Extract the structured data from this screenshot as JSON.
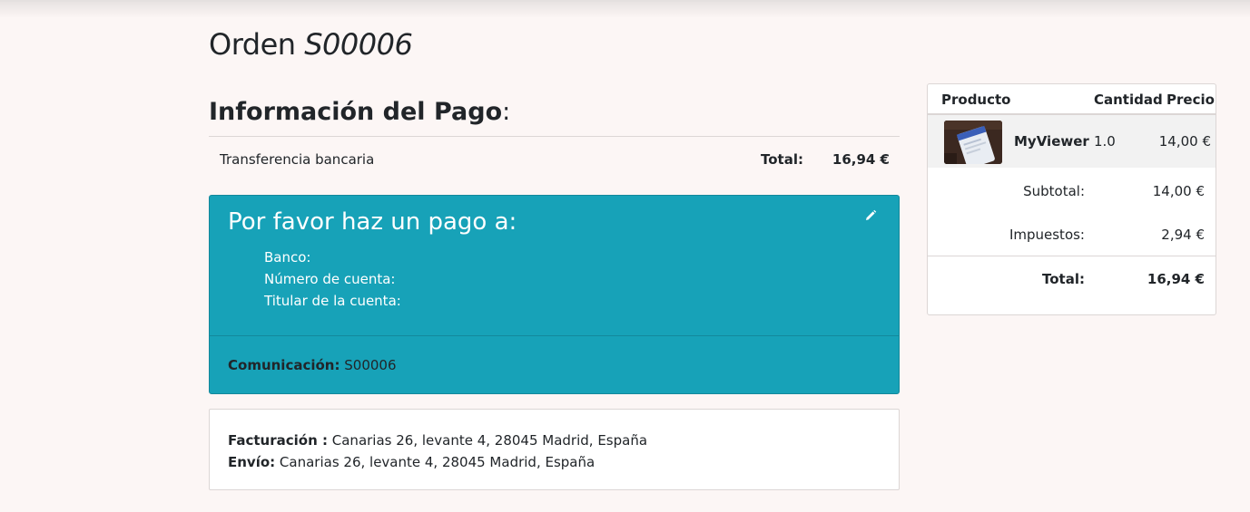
{
  "order": {
    "title_prefix": "Orden",
    "number": "S00006"
  },
  "payment": {
    "section_title": "Información del Pago",
    "section_colon": ":",
    "method": "Transferencia bancaria",
    "total_label": "Total:",
    "total_value": "16,94 €"
  },
  "bank_box": {
    "heading": "Por favor haz un pago a:",
    "lines": [
      "Banco:",
      "Número de cuenta:",
      "Titular de la cuenta:"
    ],
    "communication_label": "Comunicación:",
    "communication_value": " S00006",
    "edit_icon": "pencil-icon",
    "bg_color": "#17a2b8"
  },
  "addresses": {
    "billing_label": "Facturación :",
    "billing_value": " Canarias 26, levante 4, 28045 Madrid, España",
    "shipping_label": "Envío:",
    "shipping_value": " Canarias 26, levante 4, 28045 Madrid, España"
  },
  "summary": {
    "headers": [
      "Producto",
      "Cantidad",
      "Precio"
    ],
    "products": [
      {
        "name": "MyViewer",
        "qty": "1.0",
        "price": "14,00 €",
        "image": "product-thumbnail"
      }
    ],
    "subtotal_label": "Subtotal:",
    "subtotal_value": "14,00 €",
    "taxes_label": "Impuestos:",
    "taxes_value": "2,94 €",
    "total_label": "Total:",
    "total_value": "16,94 €"
  }
}
